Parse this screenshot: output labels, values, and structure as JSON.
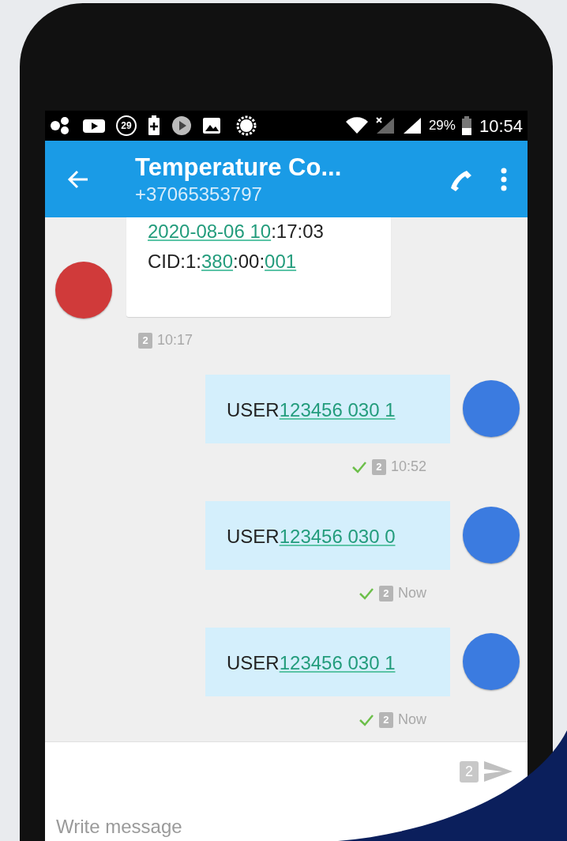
{
  "status_bar": {
    "notification_count": "29",
    "battery": "29%",
    "time": "10:54"
  },
  "app_bar": {
    "title": "Temperature Co...",
    "subtitle": "+37065353797"
  },
  "messages": [
    {
      "kind": "incoming",
      "lines": [
        [
          {
            "text": "2020-08-06 10",
            "link": true
          },
          {
            "text": ":17:03",
            "link": false
          }
        ],
        [
          {
            "text": "CID:1:",
            "link": false
          },
          {
            "text": "380",
            "link": true
          },
          {
            "text": ":00:",
            "link": false
          },
          {
            "text": "001",
            "link": true
          }
        ]
      ],
      "sim": "2",
      "time": "10:17",
      "delivered": false
    },
    {
      "kind": "outgoing",
      "lines": [
        [
          {
            "text": "USER",
            "link": false
          },
          {
            "text": "123456 030 1",
            "link": true
          }
        ]
      ],
      "sim": "2",
      "time": "10:52",
      "delivered": true
    },
    {
      "kind": "outgoing",
      "lines": [
        [
          {
            "text": "USER",
            "link": false
          },
          {
            "text": "123456 030 0",
            "link": true
          }
        ]
      ],
      "sim": "2",
      "time": "Now",
      "delivered": true
    },
    {
      "kind": "outgoing",
      "lines": [
        [
          {
            "text": "USER",
            "link": false
          },
          {
            "text": "123456 030 1",
            "link": true
          }
        ]
      ],
      "sim": "2",
      "time": "Now",
      "delivered": true
    }
  ],
  "composer": {
    "sim": "2",
    "placeholder": "Write message"
  }
}
